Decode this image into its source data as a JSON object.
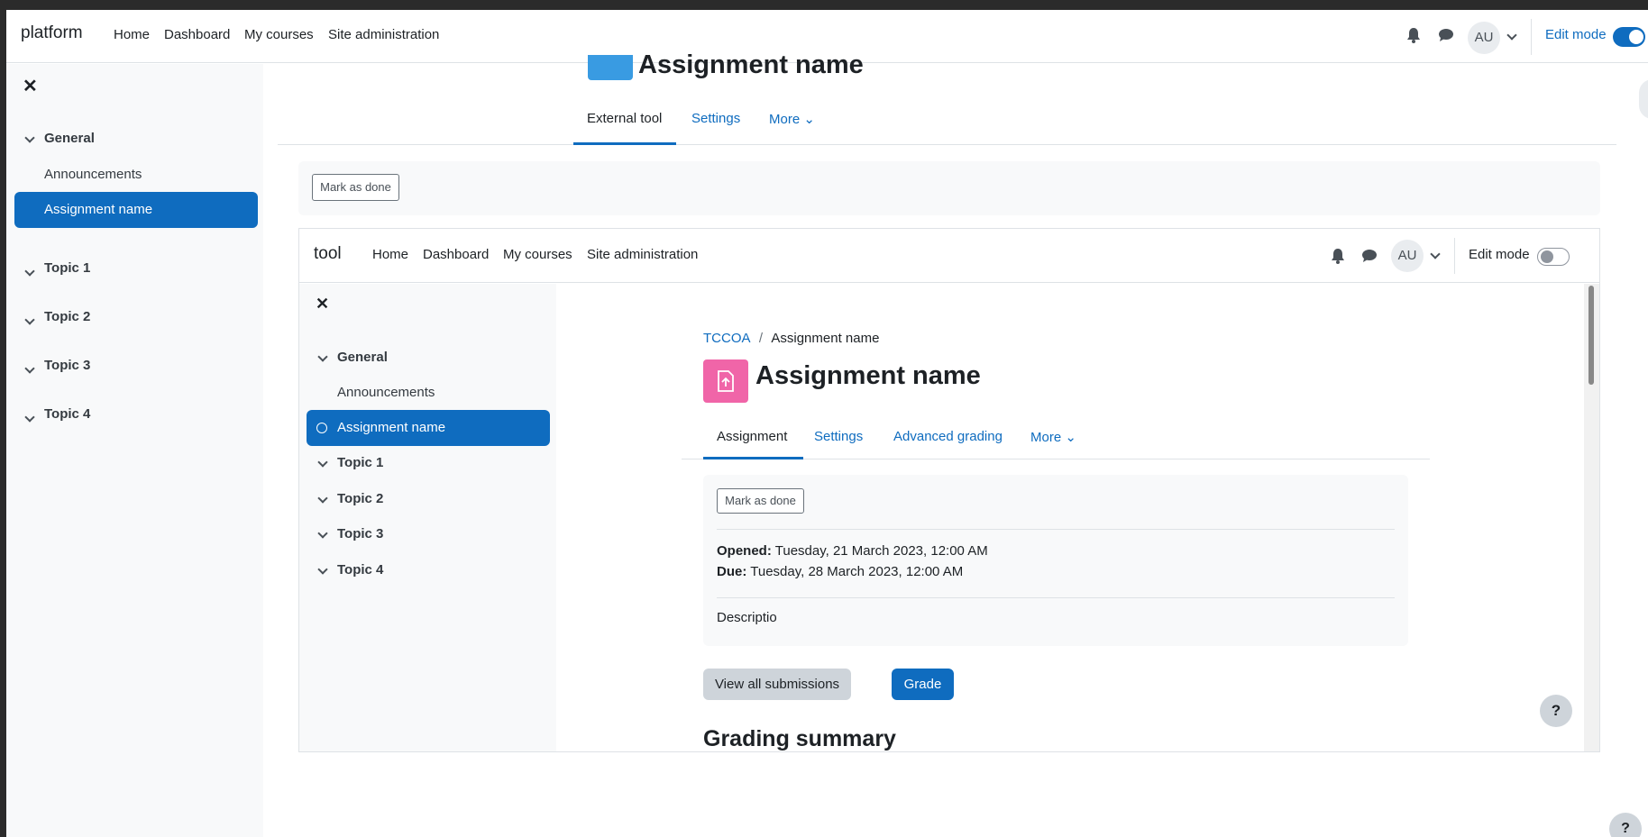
{
  "outer": {
    "navbar": {
      "brand": "platform",
      "links": [
        "Home",
        "Dashboard",
        "My courses",
        "Site administration"
      ],
      "avatar": "AU",
      "edit_mode_label": "Edit mode",
      "edit_mode_on": true
    },
    "drawer": {
      "sections": [
        {
          "title": "General",
          "items": [
            "Announcements",
            "Assignment name"
          ]
        },
        {
          "title": "Topic 1"
        },
        {
          "title": "Topic 2"
        },
        {
          "title": "Topic 3"
        },
        {
          "title": "Topic 4"
        }
      ]
    },
    "page_title": "Assignment name",
    "tabs": [
      "External tool",
      "Settings",
      "More"
    ],
    "mark_done": "Mark as done",
    "help": "?"
  },
  "inner": {
    "navbar": {
      "brand": "tool",
      "links": [
        "Home",
        "Dashboard",
        "My courses",
        "Site administration"
      ],
      "avatar": "AU",
      "edit_mode_label": "Edit mode",
      "edit_mode_on": false
    },
    "drawer": {
      "sections": [
        {
          "title": "General",
          "items": [
            "Announcements",
            "Assignment name"
          ]
        },
        {
          "title": "Topic 1"
        },
        {
          "title": "Topic 2"
        },
        {
          "title": "Topic 3"
        },
        {
          "title": "Topic 4"
        }
      ]
    },
    "breadcrumb": {
      "course": "TCCOA",
      "separator": "/",
      "current": "Assignment name"
    },
    "page_title": "Assignment name",
    "tabs": [
      "Assignment",
      "Settings",
      "Advanced grading",
      "More"
    ],
    "mark_done": "Mark as done",
    "dates": {
      "opened_label": "Opened:",
      "opened_value": "Tuesday, 21 March 2023, 12:00 AM",
      "due_label": "Due:",
      "due_value": "Tuesday, 28 March 2023, 12:00 AM"
    },
    "description": "Descriptio",
    "buttons": {
      "view_all": "View all submissions",
      "grade": "Grade"
    },
    "grading_summary": "Grading summary",
    "help": "?"
  },
  "colors": {
    "primary": "#0f6cbf",
    "assign_icon": "#f065a8",
    "activity_icon_outer": "#399be2"
  },
  "icons": [
    "close-icon",
    "chevron-down-icon",
    "bell-icon",
    "chat-icon",
    "assignment-upload-icon"
  ]
}
